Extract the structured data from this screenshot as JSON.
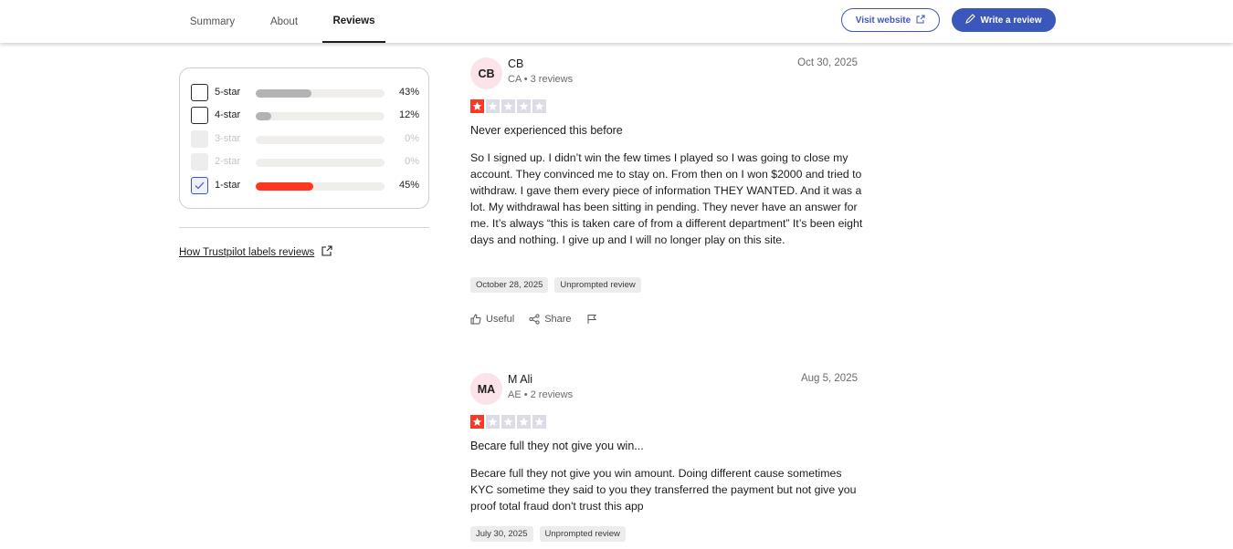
{
  "nav": {
    "tabs": [
      {
        "label": "Summary"
      },
      {
        "label": "About"
      },
      {
        "label": "Reviews"
      }
    ],
    "visit_label": "Visit website",
    "write_label": "Write a review",
    "accent": "#3c57bc"
  },
  "filters": {
    "rows": [
      {
        "label": "5-star",
        "percent": "43%",
        "value": 43
      },
      {
        "label": "4-star",
        "percent": "12%",
        "value": 12
      },
      {
        "label": "3-star",
        "percent": "0%",
        "value": 0
      },
      {
        "label": "2-star",
        "percent": "0%",
        "value": 0
      },
      {
        "label": "1-star",
        "percent": "45%",
        "value": 45
      }
    ],
    "how_link": "How Trustpilot labels reviews"
  },
  "reviews": [
    {
      "initials": "CB",
      "name": "CB",
      "meta": "CA • 3 reviews",
      "date": "Oct 30, 2025",
      "rating": 1,
      "title": "Never experienced this before",
      "body": "So I signed up. I didn’t win the few times I played so I was going to close my account. They convinced me to stay on. From then on I won $2000 and tried to withdraw. I gave them every piece of information THEY WANTED. And it was a lot. My withdrawal has been sitting in pending. They never have an answer for me. It’s always “this is taken care of from a different department” It’s been eight days and nothing. I give up and I will no longer play on this site.",
      "experience_date": "October 28, 2025",
      "tag": "Unprompted review",
      "useful": "Useful",
      "share": "Share"
    },
    {
      "initials": "MA",
      "name": "M Ali",
      "meta": "AE • 2 reviews",
      "date": "Aug 5, 2025",
      "rating": 1,
      "title": "Becare full they not give you win...",
      "body": "Becare full they not give you win amount. Doing different cause sometimes KYC sometime they said to you they transferred the payment but not give you proof total fraud don't trust this app",
      "experience_date": "July 30, 2025",
      "tag": "Unprompted review"
    }
  ],
  "colors": {
    "star_on": "#ff3722",
    "star_off": "#dcdce6",
    "avatar_bg": "#fce3e9"
  }
}
